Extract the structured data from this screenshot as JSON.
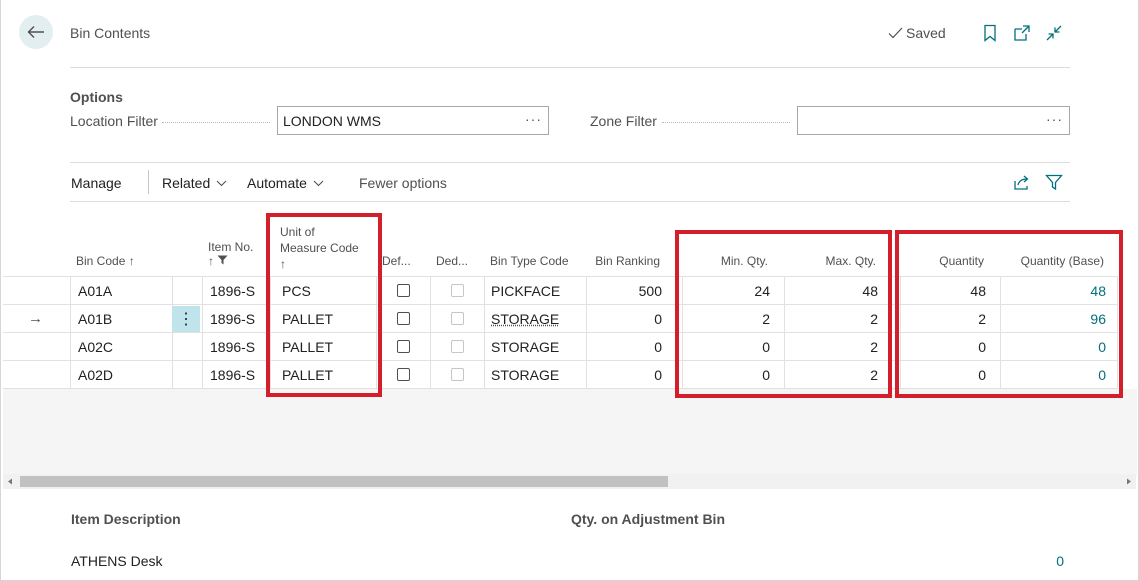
{
  "header": {
    "title": "Bin Contents",
    "saved_label": "Saved"
  },
  "options": {
    "title": "Options",
    "location_filter_label": "Location Filter",
    "location_filter_value": "LONDON WMS",
    "zone_filter_label": "Zone Filter",
    "zone_filter_value": "",
    "ellipsis": "···"
  },
  "actions": {
    "manage": "Manage",
    "related": "Related",
    "automate": "Automate",
    "fewer_options": "Fewer options"
  },
  "columns": {
    "bin_code": "Bin Code",
    "item_no": "Item No.",
    "uom_line1": "Unit of",
    "uom_line2": "Measure Code",
    "default": "Def...",
    "dedicated": "Ded...",
    "bin_type_code": "Bin Type Code",
    "bin_ranking": "Bin Ranking",
    "min_qty": "Min. Qty.",
    "max_qty": "Max. Qty.",
    "quantity": "Quantity",
    "quantity_base": "Quantity (Base)"
  },
  "rows": [
    {
      "bin_code": "A01A",
      "item_no": "1896-S",
      "uom": "PCS",
      "bin_type": "PICKFACE",
      "ranking": "500",
      "min": "24",
      "max": "48",
      "qty": "48",
      "qty_base": "48"
    },
    {
      "bin_code": "A01B",
      "item_no": "1896-S",
      "uom": "PALLET",
      "bin_type": "STORAGE",
      "ranking": "0",
      "min": "2",
      "max": "2",
      "qty": "2",
      "qty_base": "96"
    },
    {
      "bin_code": "A02C",
      "item_no": "1896-S",
      "uom": "PALLET",
      "bin_type": "STORAGE",
      "ranking": "0",
      "min": "0",
      "max": "2",
      "qty": "0",
      "qty_base": "0"
    },
    {
      "bin_code": "A02D",
      "item_no": "1896-S",
      "uom": "PALLET",
      "bin_type": "STORAGE",
      "ranking": "0",
      "min": "0",
      "max": "2",
      "qty": "0",
      "qty_base": "0"
    }
  ],
  "footer": {
    "item_description_label": "Item Description",
    "item_description_value": "ATHENS Desk",
    "qty_adjustment_label": "Qty. on Adjustment Bin",
    "qty_adjustment_value": "0"
  },
  "colors": {
    "accent": "#00707a",
    "highlight_box": "#d21f2b",
    "selected_row_marker": "#bfe4ec"
  }
}
